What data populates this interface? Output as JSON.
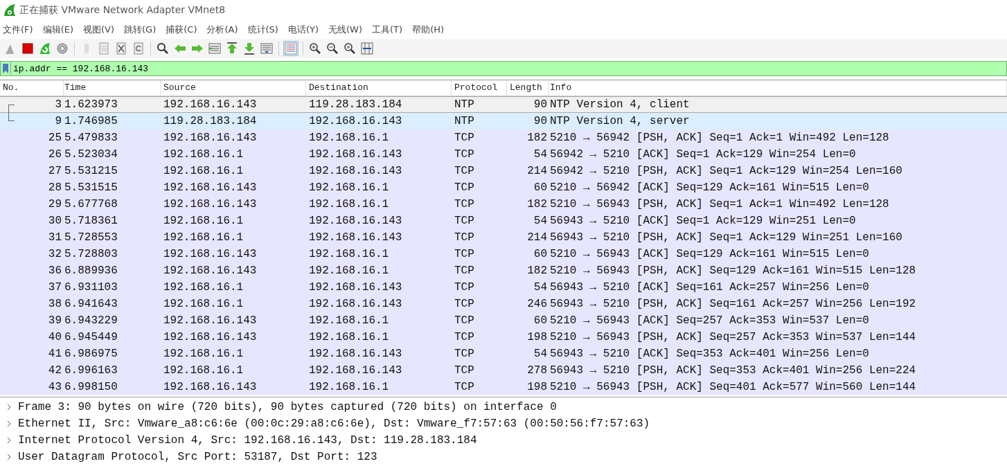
{
  "window": {
    "title": "正在捕获 VMware Network Adapter VMnet8"
  },
  "menu": [
    "文件(F)",
    "编辑(E)",
    "视图(V)",
    "跳转(G)",
    "捕获(C)",
    "分析(A)",
    "统计(S)",
    "电话(Y)",
    "无线(W)",
    "工具(T)",
    "帮助(H)"
  ],
  "filter": {
    "value": "ip.addr == 192.168.16.143"
  },
  "packet_list": {
    "columns": [
      "No.",
      "Time",
      "Source",
      "Destination",
      "Protocol",
      "Length",
      "Info"
    ],
    "rows": [
      {
        "kind": "request",
        "cells": [
          "3",
          "1.623973",
          "192.168.16.143",
          "119.28.183.184",
          "NTP",
          "90",
          "NTP Version 4, client"
        ],
        "selected": true,
        "color": "#f0f0f0"
      },
      {
        "kind": "response",
        "cells": [
          "9",
          "1.746985",
          "119.28.183.184",
          "192.168.16.143",
          "NTP",
          "90",
          "NTP Version 4, server"
        ],
        "selected": false,
        "color": "#daeeff"
      },
      {
        "kind": "plain",
        "cells": [
          "25",
          "5.479833",
          "192.168.16.143",
          "192.168.16.1",
          "TCP",
          "182",
          "5210 → 56942 [PSH, ACK] Seq=1 Ack=1 Win=492 Len=128"
        ],
        "selected": false,
        "color": "#e7e6ff"
      },
      {
        "kind": "plain",
        "cells": [
          "26",
          "5.523034",
          "192.168.16.1",
          "192.168.16.143",
          "TCP",
          "54",
          "56942 → 5210 [ACK] Seq=1 Ack=129 Win=254 Len=0"
        ],
        "selected": false,
        "color": "#e7e6ff"
      },
      {
        "kind": "plain",
        "cells": [
          "27",
          "5.531215",
          "192.168.16.1",
          "192.168.16.143",
          "TCP",
          "214",
          "56942 → 5210 [PSH, ACK] Seq=1 Ack=129 Win=254 Len=160"
        ],
        "selected": false,
        "color": "#e7e6ff"
      },
      {
        "kind": "plain",
        "cells": [
          "28",
          "5.531515",
          "192.168.16.143",
          "192.168.16.1",
          "TCP",
          "60",
          "5210 → 56942 [ACK] Seq=129 Ack=161 Win=515 Len=0"
        ],
        "selected": false,
        "color": "#e7e6ff"
      },
      {
        "kind": "plain",
        "cells": [
          "29",
          "5.677768",
          "192.168.16.143",
          "192.168.16.1",
          "TCP",
          "182",
          "5210 → 56943 [PSH, ACK] Seq=1 Ack=1 Win=492 Len=128"
        ],
        "selected": false,
        "color": "#e7e6ff"
      },
      {
        "kind": "plain",
        "cells": [
          "30",
          "5.718361",
          "192.168.16.1",
          "192.168.16.143",
          "TCP",
          "54",
          "56943 → 5210 [ACK] Seq=1 Ack=129 Win=251 Len=0"
        ],
        "selected": false,
        "color": "#e7e6ff"
      },
      {
        "kind": "plain",
        "cells": [
          "31",
          "5.728553",
          "192.168.16.1",
          "192.168.16.143",
          "TCP",
          "214",
          "56943 → 5210 [PSH, ACK] Seq=1 Ack=129 Win=251 Len=160"
        ],
        "selected": false,
        "color": "#e7e6ff"
      },
      {
        "kind": "plain",
        "cells": [
          "32",
          "5.728803",
          "192.168.16.143",
          "192.168.16.1",
          "TCP",
          "60",
          "5210 → 56943 [ACK] Seq=129 Ack=161 Win=515 Len=0"
        ],
        "selected": false,
        "color": "#e7e6ff"
      },
      {
        "kind": "plain",
        "cells": [
          "36",
          "6.889936",
          "192.168.16.143",
          "192.168.16.1",
          "TCP",
          "182",
          "5210 → 56943 [PSH, ACK] Seq=129 Ack=161 Win=515 Len=128"
        ],
        "selected": false,
        "color": "#e7e6ff"
      },
      {
        "kind": "plain",
        "cells": [
          "37",
          "6.931103",
          "192.168.16.1",
          "192.168.16.143",
          "TCP",
          "54",
          "56943 → 5210 [ACK] Seq=161 Ack=257 Win=256 Len=0"
        ],
        "selected": false,
        "color": "#e7e6ff"
      },
      {
        "kind": "plain",
        "cells": [
          "38",
          "6.941643",
          "192.168.16.1",
          "192.168.16.143",
          "TCP",
          "246",
          "56943 → 5210 [PSH, ACK] Seq=161 Ack=257 Win=256 Len=192"
        ],
        "selected": false,
        "color": "#e7e6ff"
      },
      {
        "kind": "plain",
        "cells": [
          "39",
          "6.943229",
          "192.168.16.143",
          "192.168.16.1",
          "TCP",
          "60",
          "5210 → 56943 [ACK] Seq=257 Ack=353 Win=537 Len=0"
        ],
        "selected": false,
        "color": "#e7e6ff"
      },
      {
        "kind": "plain",
        "cells": [
          "40",
          "6.945449",
          "192.168.16.143",
          "192.168.16.1",
          "TCP",
          "198",
          "5210 → 56943 [PSH, ACK] Seq=257 Ack=353 Win=537 Len=144"
        ],
        "selected": false,
        "color": "#e7e6ff"
      },
      {
        "kind": "plain",
        "cells": [
          "41",
          "6.986975",
          "192.168.16.1",
          "192.168.16.143",
          "TCP",
          "54",
          "56943 → 5210 [ACK] Seq=353 Ack=401 Win=256 Len=0"
        ],
        "selected": false,
        "color": "#e7e6ff"
      },
      {
        "kind": "plain",
        "cells": [
          "42",
          "6.996163",
          "192.168.16.1",
          "192.168.16.143",
          "TCP",
          "278",
          "56943 → 5210 [PSH, ACK] Seq=353 Ack=401 Win=256 Len=224"
        ],
        "selected": false,
        "color": "#e7e6ff"
      },
      {
        "kind": "plain",
        "cells": [
          "43",
          "6.998150",
          "192.168.16.143",
          "192.168.16.1",
          "TCP",
          "198",
          "5210 → 56943 [PSH, ACK] Seq=401 Ack=577 Win=560 Len=144"
        ],
        "selected": false,
        "color": "#e7e6ff"
      }
    ]
  },
  "details": [
    {
      "text": "Frame 3: 90 bytes on wire (720 bits), 90 bytes captured (720 bits) on interface 0",
      "expanded": false
    },
    {
      "text": "Ethernet II, Src: Vmware_a8:c6:6e (00:0c:29:a8:c6:6e), Dst: Vmware_f7:57:63 (00:50:56:f7:57:63)",
      "expanded": false
    },
    {
      "text": "Internet Protocol Version 4, Src: 192.168.16.143, Dst: 119.28.183.184",
      "expanded": false
    },
    {
      "text": "User Datagram Protocol, Src Port: 53187, Dst Port: 123",
      "expanded": false
    }
  ]
}
